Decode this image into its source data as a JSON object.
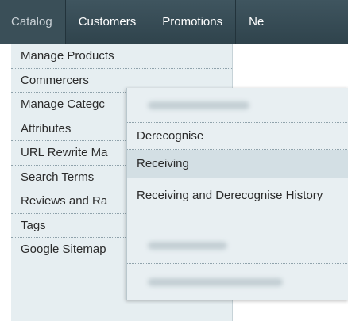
{
  "topnav": {
    "items": [
      {
        "label": "Catalog"
      },
      {
        "label": "Customers"
      },
      {
        "label": "Promotions"
      },
      {
        "label": "Ne"
      }
    ]
  },
  "catalog_menu": {
    "items": [
      {
        "label": "Manage Products"
      },
      {
        "label": "Commercers"
      },
      {
        "label": "Manage Categc"
      },
      {
        "label": "Attributes"
      },
      {
        "label": "URL Rewrite Ma"
      },
      {
        "label": "Search Terms"
      },
      {
        "label": "Reviews and Ra"
      },
      {
        "label": "Tags"
      },
      {
        "label": "Google Sitemap"
      }
    ]
  },
  "submenu": {
    "items": [
      {
        "label": "Derecognise"
      },
      {
        "label": "Receiving"
      },
      {
        "label": "Receiving and Derecognise History"
      }
    ]
  }
}
